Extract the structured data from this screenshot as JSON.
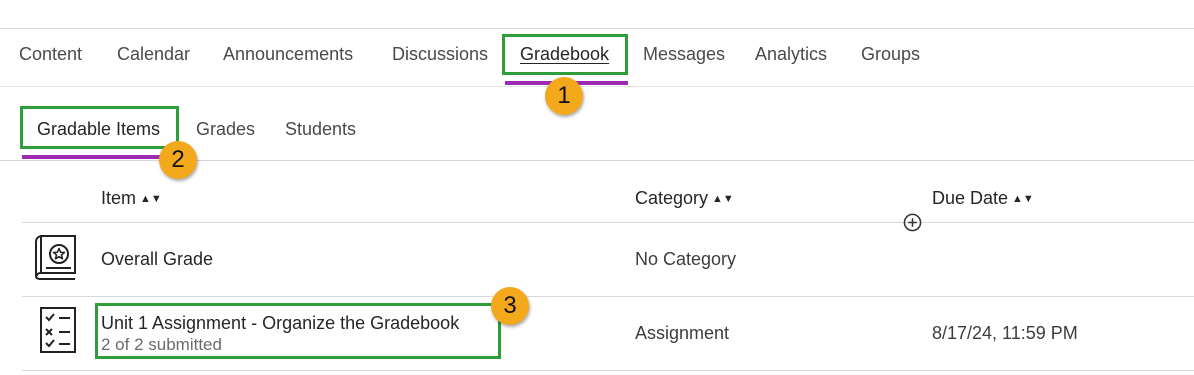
{
  "top_nav": {
    "tabs": [
      "Content",
      "Calendar",
      "Announcements",
      "Discussions",
      "Gradebook",
      "Messages",
      "Analytics",
      "Groups"
    ],
    "active": "Gradebook"
  },
  "sub_nav": {
    "tabs": [
      "Gradable Items",
      "Grades",
      "Students"
    ],
    "active": "Gradable Items"
  },
  "table": {
    "headers": {
      "item": "Item",
      "category": "Category",
      "due_date": "Due Date"
    },
    "sort_glyph": "▲▼",
    "rows": [
      {
        "icon": "overall-grade-icon",
        "title": "Overall Grade",
        "category": "No Category",
        "due": ""
      },
      {
        "icon": "assignment-checklist-icon",
        "title": "Unit 1 Assignment - Organize the Gradebook",
        "subtitle": "2 of 2 submitted",
        "category": "Assignment",
        "due": "8/17/24, 11:59 PM"
      }
    ]
  },
  "callouts": [
    "1",
    "2",
    "3"
  ],
  "colors": {
    "highlight": "#2f9e3a",
    "badge": "#f4a91c",
    "active_underline": "#9c2bb3"
  }
}
